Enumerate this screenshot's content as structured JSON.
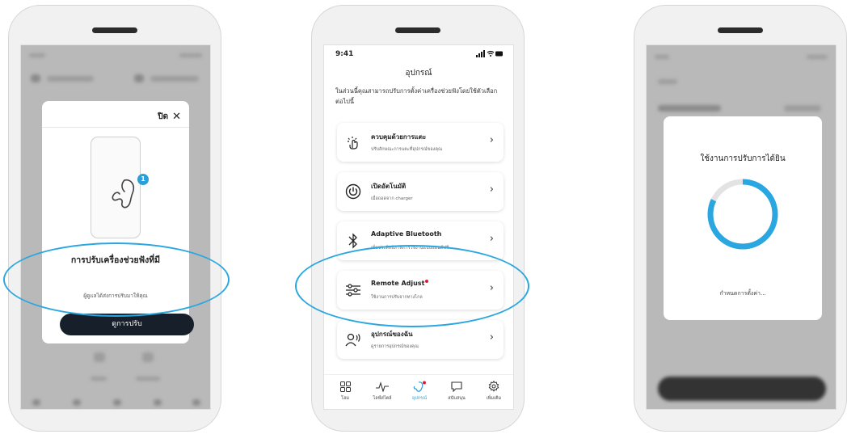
{
  "colors": {
    "accent": "#2aa7e0",
    "button_dark": "#17202a",
    "notification_red": "#d81b3a"
  },
  "phone1": {
    "close_label": "ปิด",
    "close_icon": "close-icon",
    "dialog_title": "การปรับเครื่องช่วยฟังที่มี",
    "dialog_subtitle": "ผู้ดูแลได้ส่งการปรับมาให้คุณ",
    "view_button": "ดูการปรับ",
    "badge_count": "1"
  },
  "phone2": {
    "status": {
      "time": "9:41",
      "icons": "signal-wifi-battery"
    },
    "title": "อุปกรณ์",
    "intro": "ในส่วนนี้คุณสามารถปรับการตั้งค่าเครื่องช่วยฟังโดยใช้ตัวเลือกต่อไปนี้",
    "items": [
      {
        "title": "ควบคุมด้วยการแตะ",
        "subtitle": "ปรับลักษณะการแตะที่อุปกรณ์ของคุณ",
        "icon": "tap-icon"
      },
      {
        "title": "เปิดอัตโนมัติ",
        "subtitle": "เมื่อถอดจาก charger",
        "icon": "power-icon"
      },
      {
        "title": "Adaptive Bluetooth",
        "subtitle": "เพิ่มประสิทธิภาพการใช้งานแบบแฮนด์ฟรี",
        "icon": "bluetooth-icon"
      },
      {
        "title": "Remote Adjust",
        "subtitle": "ใช้งานการปรับจากทางไกล",
        "icon": "sliders-icon"
      },
      {
        "title": "อุปกรณ์ของฉัน",
        "subtitle": "ดูรายการอุปกรณ์ของคุณ",
        "icon": "user-devices-icon"
      }
    ],
    "tabs": [
      {
        "label": "โฮม",
        "icon": "grid-icon"
      },
      {
        "label": "ไลฟ์สไตล์",
        "icon": "pulse-icon"
      },
      {
        "label": "อุปกรณ์",
        "icon": "hearing-aid-icon"
      },
      {
        "label": "สนับสนุน",
        "icon": "chat-icon"
      },
      {
        "label": "เพิ่มเติม",
        "icon": "gear-icon"
      }
    ]
  },
  "phone3": {
    "dialog_title": "ใช้งานการปรับการได้ยิน",
    "status_text": "กำหนดการตั้งค่า...",
    "progress": 0.82
  }
}
